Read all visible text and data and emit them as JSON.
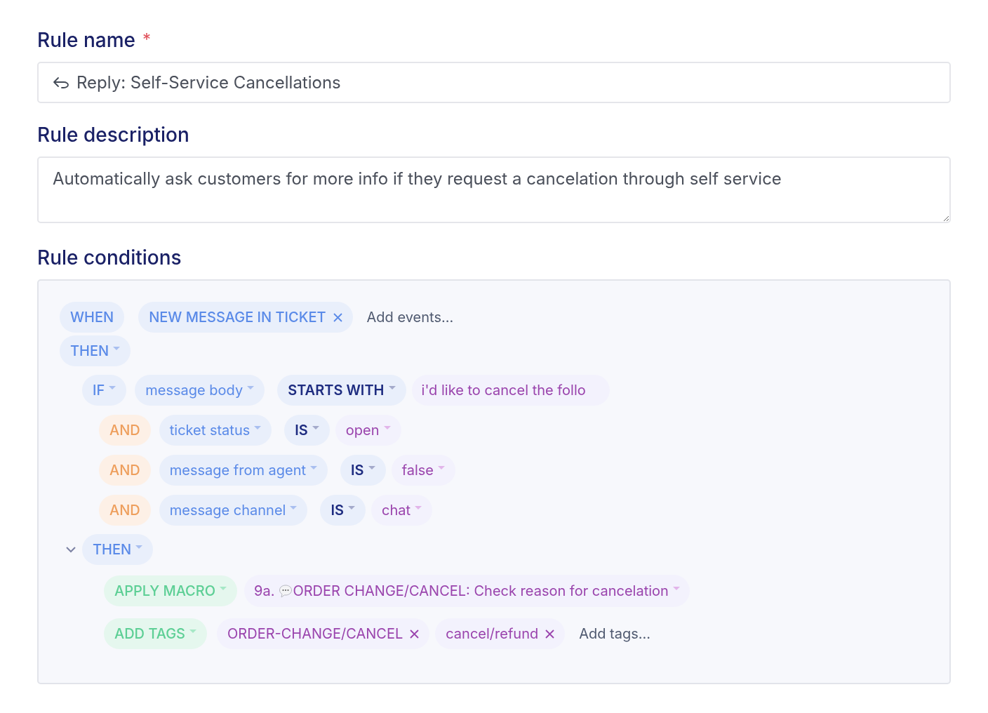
{
  "rule_name": {
    "label": "Rule name",
    "required_mark": "*",
    "value": "Reply: Self-Service Cancellations"
  },
  "rule_description": {
    "label": "Rule description",
    "value": "Automatically ask customers for more info if they request a cancelation through self service"
  },
  "rule_conditions": {
    "label": "Rule conditions",
    "trigger": {
      "keyword": "WHEN",
      "events": [
        "NEW MESSAGE IN TICKET"
      ],
      "placeholder": "Add events..."
    },
    "then": {
      "label": "THEN"
    },
    "conditions": [
      {
        "kind": "if",
        "connector": "IF",
        "field": "message body",
        "operator": "STARTS WITH",
        "value": "i'd like to cancel the follo",
        "free_text": true
      },
      {
        "kind": "and",
        "connector": "AND",
        "field": "ticket status",
        "operator": "IS",
        "value": "open",
        "free_text": false
      },
      {
        "kind": "and",
        "connector": "AND",
        "field": "message from agent",
        "operator": "IS",
        "value": "false",
        "free_text": false
      },
      {
        "kind": "and",
        "connector": "AND",
        "field": "message channel",
        "operator": "IS",
        "value": "chat",
        "free_text": false
      }
    ],
    "actions_block": {
      "label": "THEN",
      "expanded": true,
      "actions": [
        {
          "kind": "macro",
          "label": "APPLY MACRO",
          "prefix": "9a.",
          "value": "ORDER CHANGE/CANCEL: Check reason for cancelation"
        },
        {
          "kind": "tags",
          "label": "ADD TAGS",
          "tags": [
            "ORDER-CHANGE/CANCEL",
            "cancel/refund"
          ],
          "placeholder": "Add tags..."
        }
      ]
    }
  }
}
